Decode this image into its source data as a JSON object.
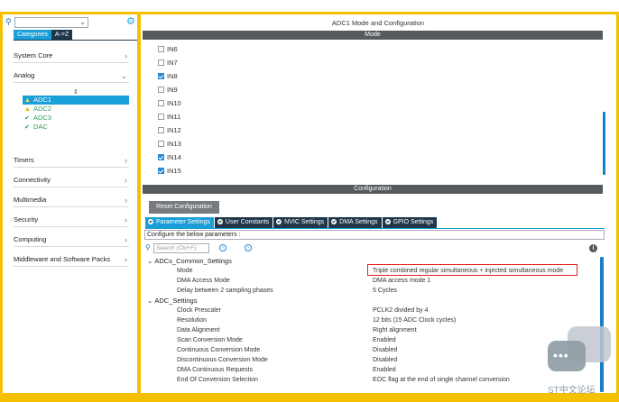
{
  "search": {
    "placeholder": ""
  },
  "categories_tabs": [
    "Categories",
    "A->Z"
  ],
  "menu": {
    "system_core": "System Core",
    "analog": "Analog",
    "analog_items": [
      {
        "label": "ADC1",
        "status": "warn"
      },
      {
        "label": "ADC2",
        "status": "warn"
      },
      {
        "label": "ADC3",
        "status": "ok"
      },
      {
        "label": "DAC",
        "status": "ok"
      }
    ],
    "timers": "Timers",
    "connectivity": "Connectivity",
    "multimedia": "Multimedia",
    "security": "Security",
    "computing": "Computing",
    "middleware": "Middleware and Software Packs"
  },
  "header": {
    "title": "ADC1 Mode and Configuration",
    "mode_bar": "Mode",
    "config_bar": "Configuration"
  },
  "channels": [
    {
      "label": "IN6",
      "checked": false
    },
    {
      "label": "IN7",
      "checked": false
    },
    {
      "label": "IN8",
      "checked": true
    },
    {
      "label": "IN9",
      "checked": false
    },
    {
      "label": "IN10",
      "checked": false
    },
    {
      "label": "IN11",
      "checked": false
    },
    {
      "label": "IN12",
      "checked": false
    },
    {
      "label": "IN13",
      "checked": false
    },
    {
      "label": "IN14",
      "checked": true
    },
    {
      "label": "IN15",
      "checked": true
    }
  ],
  "config": {
    "reset_label": "Reset Configuration",
    "tabs": [
      "Parameter Settings",
      "User Constants",
      "NVIC Settings",
      "DMA Settings",
      "GPIO Settings"
    ],
    "hint": "Configure the below parameters :",
    "search_placeholder": "Search (Ctrl+F)",
    "groups": [
      {
        "name": "ADCs_Common_Settings",
        "params": [
          {
            "key": "Mode",
            "value": "Triple combined regular simultaneous + injected simultaneous mode"
          },
          {
            "key": "DMA Access Mode",
            "value": "DMA access mode 1"
          },
          {
            "key": "Delay between 2 sampling phases",
            "value": "5 Cycles"
          }
        ]
      },
      {
        "name": "ADC_Settings",
        "params": [
          {
            "key": "Clock Prescaler",
            "value": "PCLK2 divided by 4"
          },
          {
            "key": "Resolution",
            "value": "12 bits (15 ADC Clock cycles)"
          },
          {
            "key": "Data Alignment",
            "value": "Right alignment"
          },
          {
            "key": "Scan Conversion Mode",
            "value": "Enabled"
          },
          {
            "key": "Continuous Conversion Mode",
            "value": "Disabled"
          },
          {
            "key": "Discontinuous Conversion Mode",
            "value": "Disabled"
          },
          {
            "key": "DMA Continuous Requests",
            "value": "Enabled"
          },
          {
            "key": "End Of Conversion Selection",
            "value": "EOC flag at the end of single channel conversion"
          }
        ]
      }
    ]
  },
  "watermark": "ST中文论坛",
  "colors": {
    "accent": "#1a9ed8",
    "frame": "#f5c000",
    "highlight": "#e02020"
  }
}
